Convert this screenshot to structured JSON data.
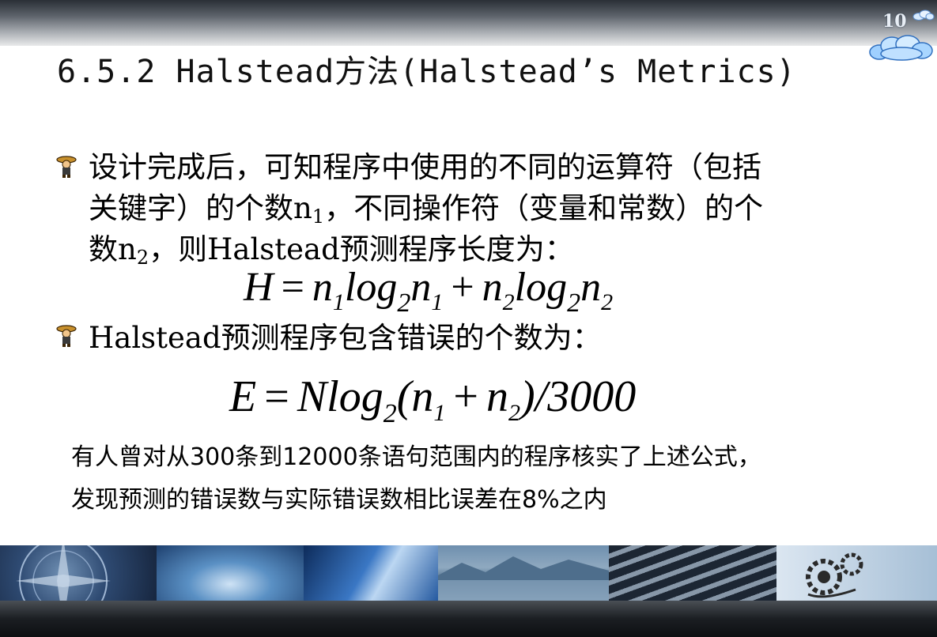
{
  "slide": {
    "number": "10",
    "title": "6.5.2  Halstead方法(Halstead’s Metrics)"
  },
  "bullets": [
    {
      "line1": "设计完成后，可知程序中使用的不同的运算符（包括",
      "line2_a": "关键字）的个数n",
      "line2_sub": "1",
      "line2_b": "，不同操作符（变量和常数）的个",
      "line3_a": "数n",
      "line3_sub": "2",
      "line3_b": "，则Halstead预测程序长度为："
    },
    {
      "text": "Halstead预测程序包含错误的个数为："
    }
  ],
  "formula_h": {
    "lhs": "H",
    "eq": "=",
    "t1": "n",
    "t1_sub": "1",
    "log1": "log",
    "log1_sub": "2",
    "t2": "n",
    "t2_sub": "1",
    "plus": "+",
    "t3": "n",
    "t3_sub": "2",
    "log2": "log",
    "log2_sub": "2",
    "t4": "n",
    "t4_sub": "2"
  },
  "formula_e": {
    "lhs": "E",
    "eq": "=",
    "n": "Nlog",
    "log_sub": "2",
    "open": "(n",
    "n1_sub": "1",
    "plus": "+",
    "n2": "n",
    "n2_sub": "2",
    "close": ")/3000"
  },
  "note": {
    "line1": "有人曾对从300条到12000条语句范围内的程序核实了上述公式，",
    "line2": "发现预测的错误数与实际错误数相比误差在8%之内"
  },
  "icons": {
    "bullet": "cartoon-figure-icon",
    "cloud": "cloud-icon"
  }
}
